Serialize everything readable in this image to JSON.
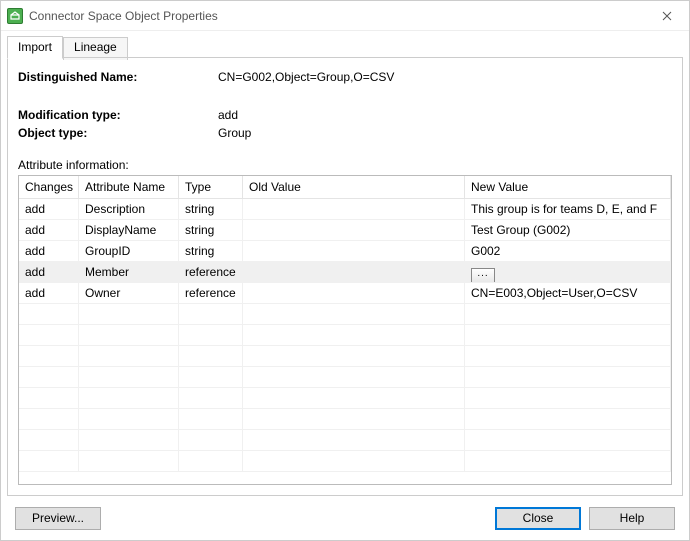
{
  "window": {
    "title": "Connector Space Object Properties"
  },
  "tabs": [
    {
      "label": "Import",
      "active": true
    },
    {
      "label": "Lineage",
      "active": false
    }
  ],
  "fields": {
    "dn_label": "Distinguished Name:",
    "dn_value": "CN=G002,Object=Group,O=CSV",
    "modtype_label": "Modification type:",
    "modtype_value": "add",
    "objtype_label": "Object type:",
    "objtype_value": "Group",
    "attrinfo_label": "Attribute information:"
  },
  "columns": {
    "c0": "Changes",
    "c1": "Attribute Name",
    "c2": "Type",
    "c3": "Old Value",
    "c4": "New Value"
  },
  "rows": [
    {
      "changes": "add",
      "name": "Description",
      "type": "string",
      "old": "",
      "new": "This group is for teams D, E, and F",
      "selected": false,
      "ellipsis": false
    },
    {
      "changes": "add",
      "name": "DisplayName",
      "type": "string",
      "old": "",
      "new": "Test Group (G002)",
      "selected": false,
      "ellipsis": false
    },
    {
      "changes": "add",
      "name": "GroupID",
      "type": "string",
      "old": "",
      "new": "G002",
      "selected": false,
      "ellipsis": false
    },
    {
      "changes": "add",
      "name": "Member",
      "type": "reference",
      "old": "",
      "new": "",
      "selected": true,
      "ellipsis": true
    },
    {
      "changes": "add",
      "name": "Owner",
      "type": "reference",
      "old": "",
      "new": "CN=E003,Object=User,O=CSV",
      "selected": false,
      "ellipsis": false
    }
  ],
  "empty_rows": 8,
  "buttons": {
    "preview": "Preview...",
    "close": "Close",
    "help": "Help"
  }
}
